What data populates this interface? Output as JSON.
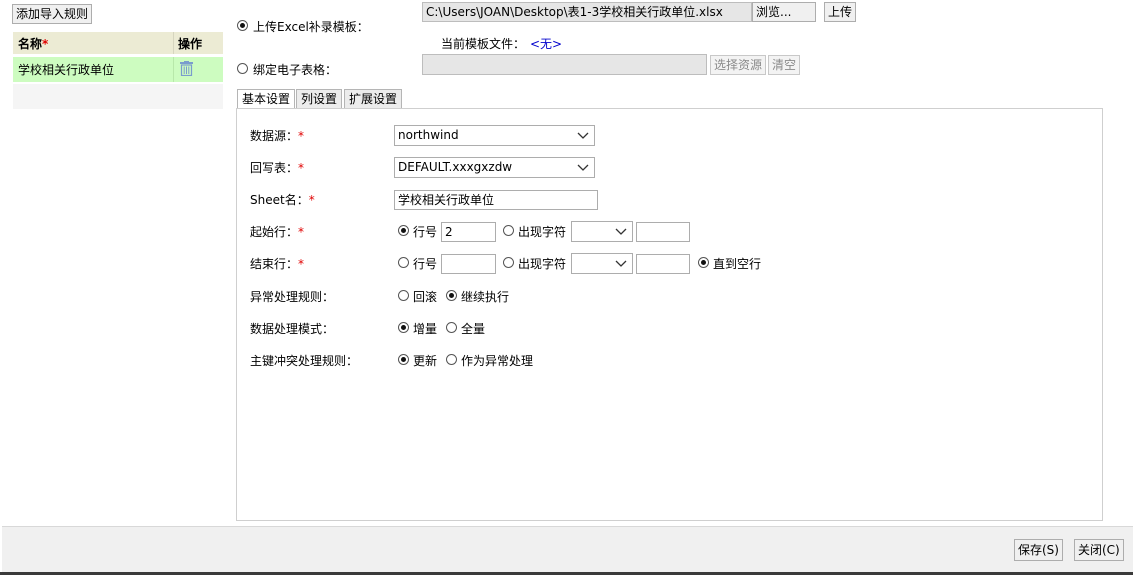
{
  "left": {
    "add_rule_button": "添加导入规则",
    "table": {
      "col_name": "名称",
      "col_name_required": "*",
      "col_action": "操作",
      "rows": [
        {
          "name": "学校相关行政单位"
        }
      ]
    }
  },
  "source": {
    "upload_label": "上传Excel补录模板：",
    "file_path": "C:\\Users\\JOAN\\Desktop\\表1-3学校相关行政单位.xlsx",
    "browse": "浏览...",
    "upload": "上传",
    "current_template_label": "当前模板文件：",
    "current_template_value": "<无>",
    "bind_label": "绑定电子表格：",
    "select_resource": "选择资源",
    "clear": "清空"
  },
  "tabs": [
    "基本设置",
    "列设置",
    "扩展设置"
  ],
  "form": {
    "required_mark": "*",
    "datasource_label": "数据源：",
    "datasource_value": "northwind",
    "writeback_label": "回写表：",
    "writeback_value": "DEFAULT.xxxgxzdw",
    "sheet_label": "Sheet名：",
    "sheet_value": "学校相关行政单位",
    "start_label": "起始行：",
    "row_no": "行号",
    "start_row_value": "2",
    "appear_char": "出现字符",
    "end_label": "结束行：",
    "until_empty": "直到空行",
    "error_label": "异常处理规则：",
    "rollback": "回滚",
    "continue": "继续执行",
    "mode_label": "数据处理模式：",
    "incremental": "增量",
    "full": "全量",
    "pk_label": "主键冲突处理规则：",
    "update": "更新",
    "as_error": "作为异常处理"
  },
  "footer": {
    "save": "保存(S)",
    "close": "关闭(C)"
  },
  "colors": {
    "selected_row": "#cdfcc0",
    "header_row": "#ecebd4",
    "required": "#e00000",
    "link": "#0000cc"
  },
  "icons": {
    "delete": "trash-icon",
    "dropdown": "chevron-down-icon"
  }
}
